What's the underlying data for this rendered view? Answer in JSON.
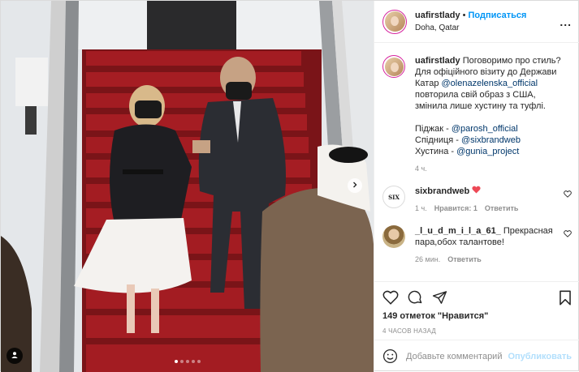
{
  "header": {
    "username": "uafirstlady",
    "separator": "•",
    "follow_label": "Подписаться",
    "location": "Doha, Qatar",
    "more_label": "..."
  },
  "caption": {
    "username": "uafirstlady",
    "line1": "Поговоримо про стиль? Для офіційного візиту до Держави Катар",
    "mention1": "@olenazelenska_official",
    "line2": "повторила свій образ з США, змінила лише хустину та туфлі.",
    "jacket_label": "Піджак - ",
    "jacket_mention": "@parosh_official",
    "skirt_label": "Спідниця - ",
    "skirt_mention": "@sixbrandweb",
    "scarf_label": "Хустина - ",
    "scarf_mention": "@gunia_project",
    "age": "4 ч."
  },
  "comments": [
    {
      "username": "sixbrandweb",
      "avatar_text": "SIX",
      "text": "",
      "age": "1 ч.",
      "likes": "Нравится: 1",
      "reply_label": "Ответить"
    },
    {
      "username": "_l_u_d_m_i_l_a_61_",
      "text": "Прекрасная пара,обох талантове!",
      "age": "26 мин.",
      "reply_label": "Ответить"
    }
  ],
  "likes_text": "149 отметок \"Нравится\"",
  "timestamp": "4 ЧАСОВ НАЗАД",
  "comment_box": {
    "placeholder": "Добавьте комментарий...",
    "publish_label": "Опубликовать"
  },
  "carousel": {
    "count": 5,
    "active_index": 0
  },
  "icons": {
    "like": "heart-icon",
    "comment": "comment-icon",
    "share": "paper-plane-icon",
    "save": "bookmark-icon",
    "emoji": "smiley-icon",
    "next": "chevron-right-icon",
    "tag": "user-tag-icon"
  },
  "colors": {
    "link": "#0095f6",
    "mention": "#00376b",
    "muted": "#8e8e8e",
    "heart_red": "#ed4956"
  }
}
